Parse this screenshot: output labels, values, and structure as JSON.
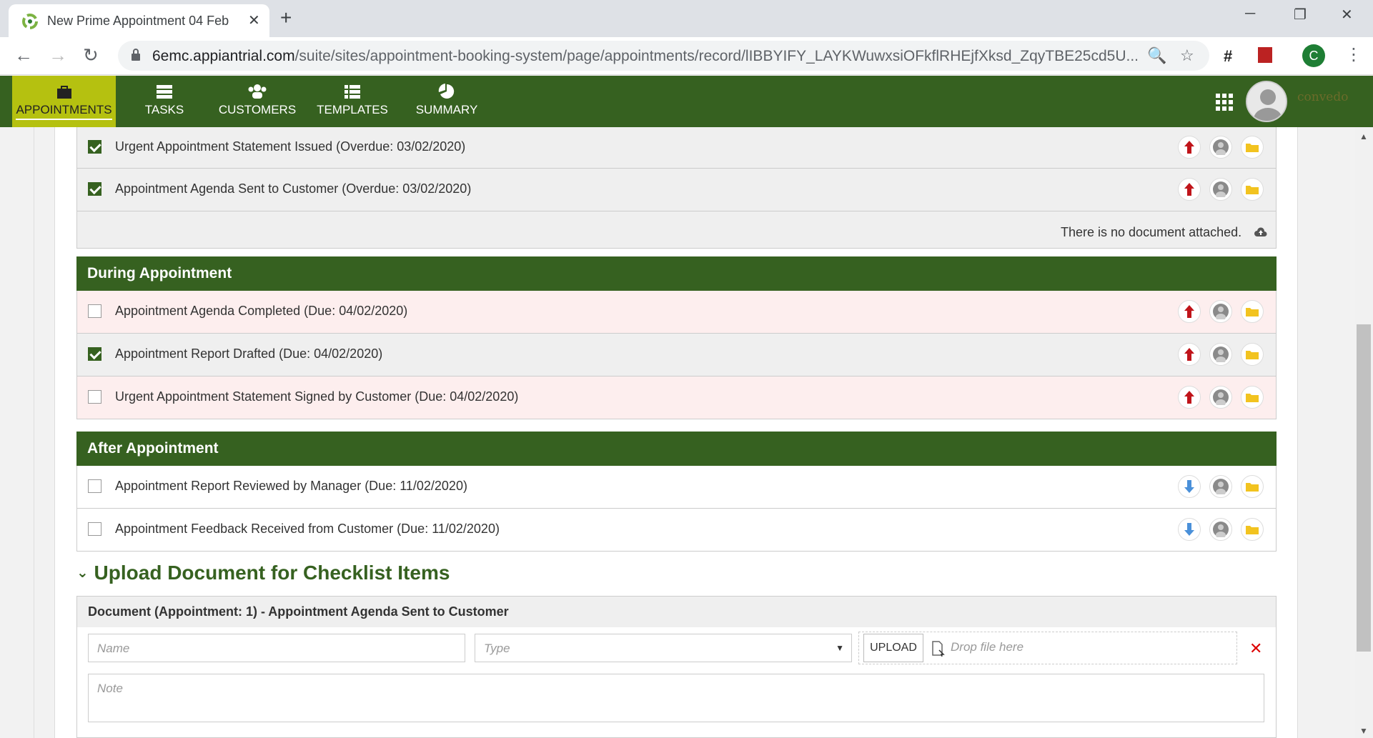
{
  "browser": {
    "tab_title": "New Prime Appointment 04 Feb",
    "url_host": "6emc.appiantrial.com",
    "url_path": "/suite/sites/appointment-booking-system/page/appointments/record/lIBBYIFY_LAYKWuwxsiOFkflRHEjfXksd_ZqyTBE25cd5U...",
    "profile_initial": "C"
  },
  "nav": {
    "items": [
      {
        "label": "APPOINTMENTS"
      },
      {
        "label": "TASKS"
      },
      {
        "label": "CUSTOMERS"
      },
      {
        "label": "TEMPLATES"
      },
      {
        "label": "SUMMARY"
      }
    ],
    "logo_text": "convedo"
  },
  "before_section": {
    "rows": [
      {
        "label": "Urgent Appointment Statement Issued (Overdue: 03/02/2020)",
        "checked": true,
        "priority": "high"
      },
      {
        "label": "Appointment Agenda Sent to Customer (Overdue: 03/02/2020)",
        "checked": true,
        "priority": "high"
      }
    ],
    "no_document": "There is no document attached."
  },
  "during_section": {
    "title": "During Appointment",
    "rows": [
      {
        "label": "Appointment Agenda Completed (Due: 04/02/2020)",
        "checked": false,
        "priority": "high"
      },
      {
        "label": "Appointment Report Drafted (Due: 04/02/2020)",
        "checked": true,
        "priority": "high"
      },
      {
        "label": "Urgent Appointment Statement Signed by Customer (Due: 04/02/2020)",
        "checked": false,
        "priority": "high"
      }
    ]
  },
  "after_section": {
    "title": "After Appointment",
    "rows": [
      {
        "label": "Appointment Report Reviewed by Manager (Due: 11/02/2020)",
        "checked": false,
        "priority": "low"
      },
      {
        "label": "Appointment Feedback Received from Customer (Due: 11/02/2020)",
        "checked": false,
        "priority": "low"
      }
    ]
  },
  "upload": {
    "title": "Upload Document for Checklist Items",
    "doc_header": "Document (Appointment: 1) - Appointment Agenda Sent to Customer",
    "name_placeholder": "Name",
    "type_placeholder": "Type",
    "upload_label": "UPLOAD",
    "drop_text": "Drop file here",
    "note_placeholder": "Note"
  },
  "colors": {
    "brand_green": "#366120",
    "active_tab": "#b5c110",
    "priority_high": "#c0141a",
    "priority_low": "#4a90d9",
    "folder": "#f2c31f"
  }
}
